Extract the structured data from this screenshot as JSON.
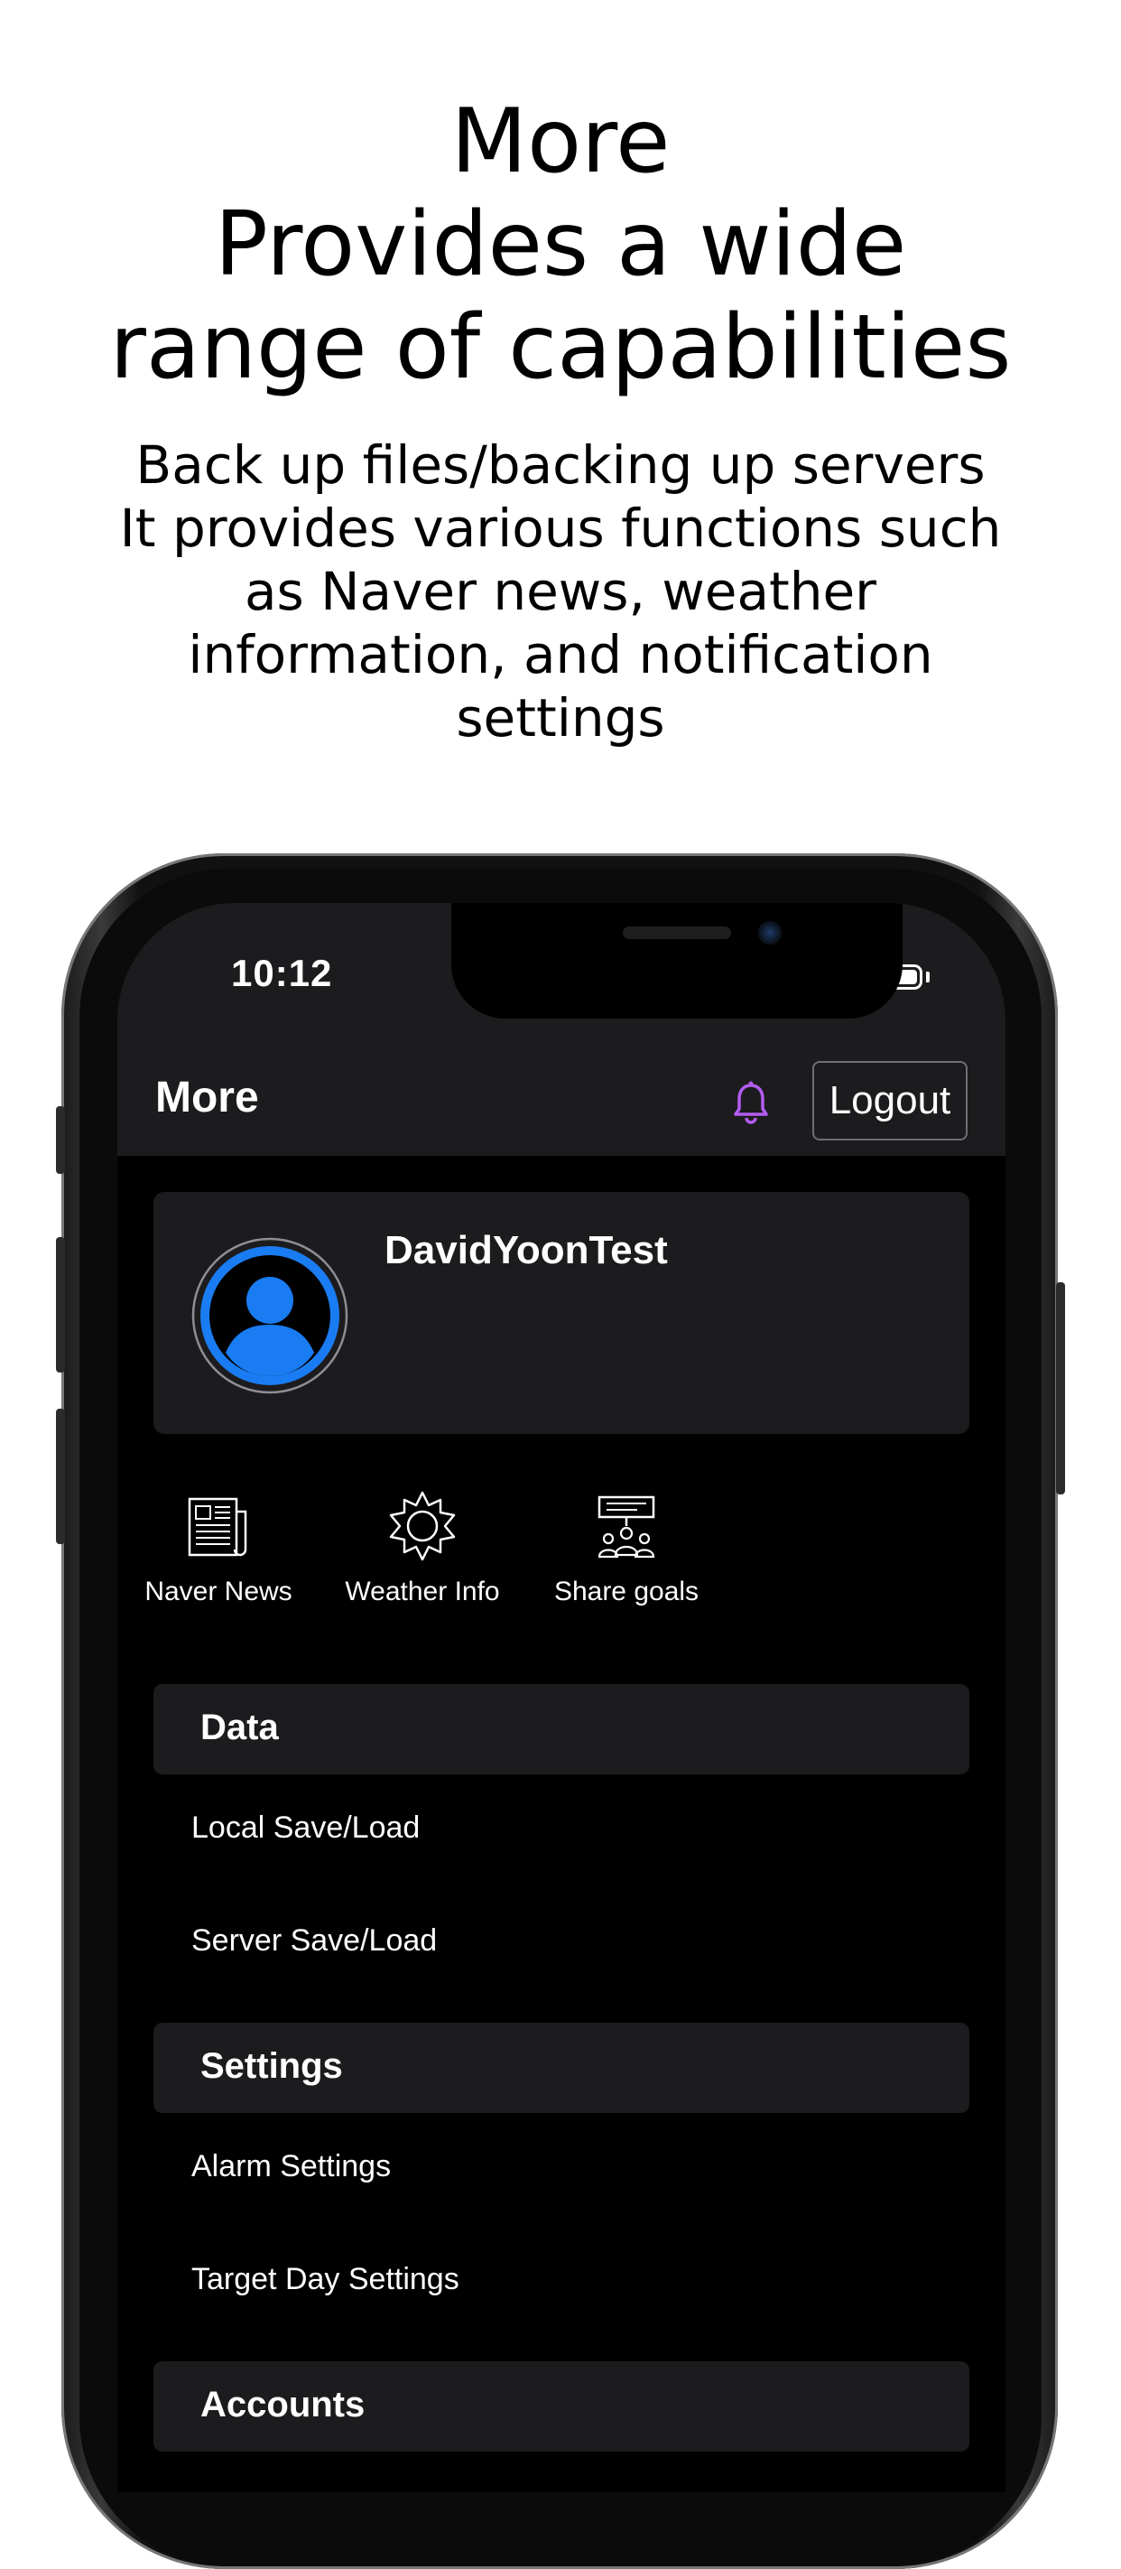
{
  "promo": {
    "headline": [
      "More",
      "Provides a wide",
      "range of capabilities"
    ],
    "subtext": [
      "Back up files/backing up servers",
      "It provides various functions such",
      "as Naver news, weather",
      "information, and notification",
      "settings"
    ]
  },
  "status_bar": {
    "time": "10:12"
  },
  "navbar": {
    "title": "More",
    "logout_label": "Logout",
    "bell_color": "#b35cf0"
  },
  "profile": {
    "username": "DavidYoonTest",
    "avatar_color": "#1a7cf2"
  },
  "quick_actions": [
    {
      "label": "Naver News",
      "icon": "newspaper-icon"
    },
    {
      "label": "Weather Info",
      "icon": "sun-icon"
    },
    {
      "label": "Share goals",
      "icon": "group-presentation-icon"
    }
  ],
  "sections": [
    {
      "title": "Data",
      "items": [
        "Local Save/Load",
        "Server Save/Load"
      ]
    },
    {
      "title": "Settings",
      "items": [
        "Alarm Settings",
        "Target Day Settings"
      ]
    },
    {
      "title": "Accounts",
      "items": []
    }
  ]
}
